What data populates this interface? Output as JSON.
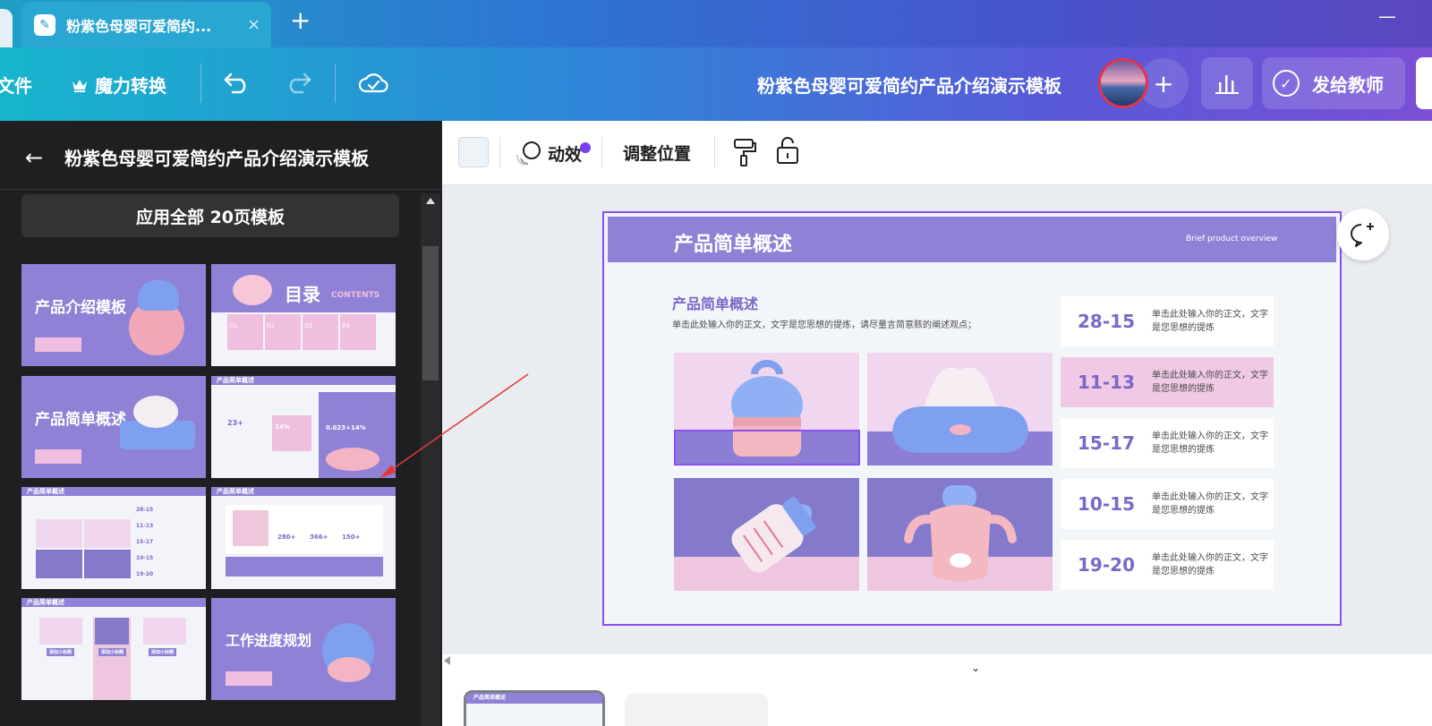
{
  "browser": {
    "tab_title": "粉紫色母婴可爱简约...",
    "tab_close": "×",
    "new_tab": "+",
    "minimize": "—"
  },
  "toolbar": {
    "file_label": "文件",
    "magic_label": "魔力转换",
    "doc_title": "粉紫色母婴可爱简约产品介绍演示模板",
    "add_collaborator": "+",
    "send_label": "发给教师"
  },
  "left_panel": {
    "title": "粉紫色母婴可爱简约产品介绍演示模板",
    "apply_all": "应用全部 20页模板",
    "thumbnails": [
      {
        "title": "产品介绍模板"
      },
      {
        "title": "目录",
        "subtitle": "CONTENTS",
        "items": [
          "01",
          "02",
          "03",
          "04"
        ]
      },
      {
        "title": "产品简单概述"
      },
      {
        "title": "产品简单概述",
        "values": [
          "23+",
          "14%",
          "0.023+14%"
        ]
      },
      {
        "title": "产品简单概述",
        "values": [
          "28-15",
          "11-13",
          "15-17",
          "10-15",
          "19-20"
        ]
      },
      {
        "title": "产品简单概述",
        "values": [
          "280+",
          "366+",
          "150+"
        ]
      },
      {
        "title": "产品简单概述",
        "items": [
          "添加小标题",
          "添加小标题",
          "添加小标题"
        ]
      },
      {
        "title": "工作进度规划"
      }
    ]
  },
  "context_bar": {
    "animation": "动效",
    "position": "调整位置"
  },
  "slide": {
    "header_title": "产品简单概述",
    "header_subtitle": "Brief product overview",
    "heading": "产品简单概述",
    "description": "单击此处输入你的正文，文字是您思想的提炼，请尽量言简意赅的阐述观点；",
    "stats": [
      {
        "value": "28-15",
        "text": "单击此处输入你的正文，文字是您思想的提炼",
        "style": "white"
      },
      {
        "value": "11-13",
        "text": "单击此处输入你的正文，文字是您思想的提炼",
        "style": "pink"
      },
      {
        "value": "15-17",
        "text": "单击此处输入你的正文，文字是您思想的提炼",
        "style": "white"
      },
      {
        "value": "10-15",
        "text": "单击此处输入你的正文，文字是您思想的提炼",
        "style": "white"
      },
      {
        "value": "19-20",
        "text": "单击此处输入你的正文，文字是您思想的提炼",
        "style": "white"
      }
    ]
  },
  "page_strip": {
    "thumb_title": "产品简单概述",
    "collapse": "⌄"
  },
  "colors": {
    "accent_purple": "#8f82d6",
    "selection": "#8b4ef0",
    "pink": "#efc9e5",
    "annotation_arrow": "#e53935"
  }
}
